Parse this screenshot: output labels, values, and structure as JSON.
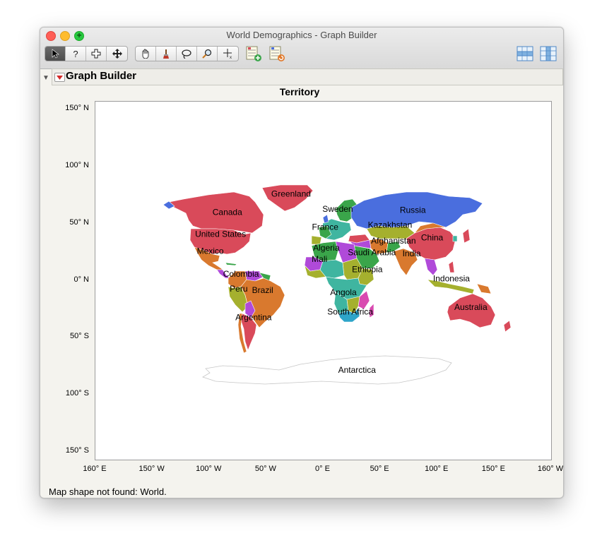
{
  "window": {
    "title": "World Demographics - Graph Builder"
  },
  "toolbar": {
    "tools": [
      {
        "name": "arrow-tool",
        "glyph": "➤"
      },
      {
        "name": "help-tool",
        "glyph": "?"
      },
      {
        "name": "selection-tool",
        "glyph": "⌖"
      },
      {
        "name": "scroller-tool",
        "glyph": "✥"
      },
      {
        "name": "grabber-tool",
        "glyph": "✋"
      },
      {
        "name": "brush-tool",
        "glyph": "🖌"
      },
      {
        "name": "lasso-tool",
        "glyph": "◯"
      },
      {
        "name": "magnifier-tool",
        "glyph": "⚲"
      },
      {
        "name": "crosshair-tool",
        "glyph": "+"
      }
    ]
  },
  "outline": {
    "title": "Graph Builder"
  },
  "chart_data": {
    "type": "map",
    "title": "Territory",
    "y_ticks": [
      "150° N",
      "100° N",
      "50° N",
      "0° N",
      "50° S",
      "100° S",
      "150° S"
    ],
    "x_ticks": [
      "160° E",
      "150° W",
      "100° W",
      "50° W",
      "0° E",
      "50° E",
      "100° E",
      "150° E",
      "160° W"
    ],
    "labels": [
      {
        "text": "Greenland",
        "lon": -28,
        "lat": 73
      },
      {
        "text": "Canada",
        "lon": -84,
        "lat": 57
      },
      {
        "text": "United States",
        "lon": -90,
        "lat": 38
      },
      {
        "text": "Mexico",
        "lon": -99,
        "lat": 23
      },
      {
        "text": "Colombia",
        "lon": -72,
        "lat": 3
      },
      {
        "text": "Peru",
        "lon": -74,
        "lat": -10
      },
      {
        "text": "Brazil",
        "lon": -53,
        "lat": -11
      },
      {
        "text": "Argentina",
        "lon": -61,
        "lat": -35
      },
      {
        "text": "Sweden",
        "lon": 13,
        "lat": 60
      },
      {
        "text": "France",
        "lon": 2,
        "lat": 44
      },
      {
        "text": "Russia",
        "lon": 79,
        "lat": 59
      },
      {
        "text": "Kazakhstan",
        "lon": 59,
        "lat": 46
      },
      {
        "text": "Afghanistan",
        "lon": 62,
        "lat": 32
      },
      {
        "text": "China",
        "lon": 96,
        "lat": 35
      },
      {
        "text": "Algeria",
        "lon": 3,
        "lat": 26
      },
      {
        "text": "Mali",
        "lon": -3,
        "lat": 16
      },
      {
        "text": "Saudi Arabia",
        "lon": 43,
        "lat": 22
      },
      {
        "text": "India",
        "lon": 78,
        "lat": 21
      },
      {
        "text": "Ethiopia",
        "lon": 39,
        "lat": 7
      },
      {
        "text": "Indonesia",
        "lon": 113,
        "lat": -1
      },
      {
        "text": "Angola",
        "lon": 18,
        "lat": -13
      },
      {
        "text": "South Africa",
        "lon": 24,
        "lat": -30
      },
      {
        "text": "Australia",
        "lon": 130,
        "lat": -26
      },
      {
        "text": "Antarctica",
        "lon": 30,
        "lat": -81
      }
    ],
    "colors": {
      "red": "#d94a5a",
      "blue": "#4a6ede",
      "orange": "#d9792e",
      "green": "#3aa54a",
      "teal": "#3fb5a0",
      "purple": "#b04ad9",
      "olive": "#a5b02e",
      "cyan": "#2ea5c9",
      "magenta": "#d94ab0"
    }
  },
  "status": {
    "message": "Map shape not found: World."
  }
}
